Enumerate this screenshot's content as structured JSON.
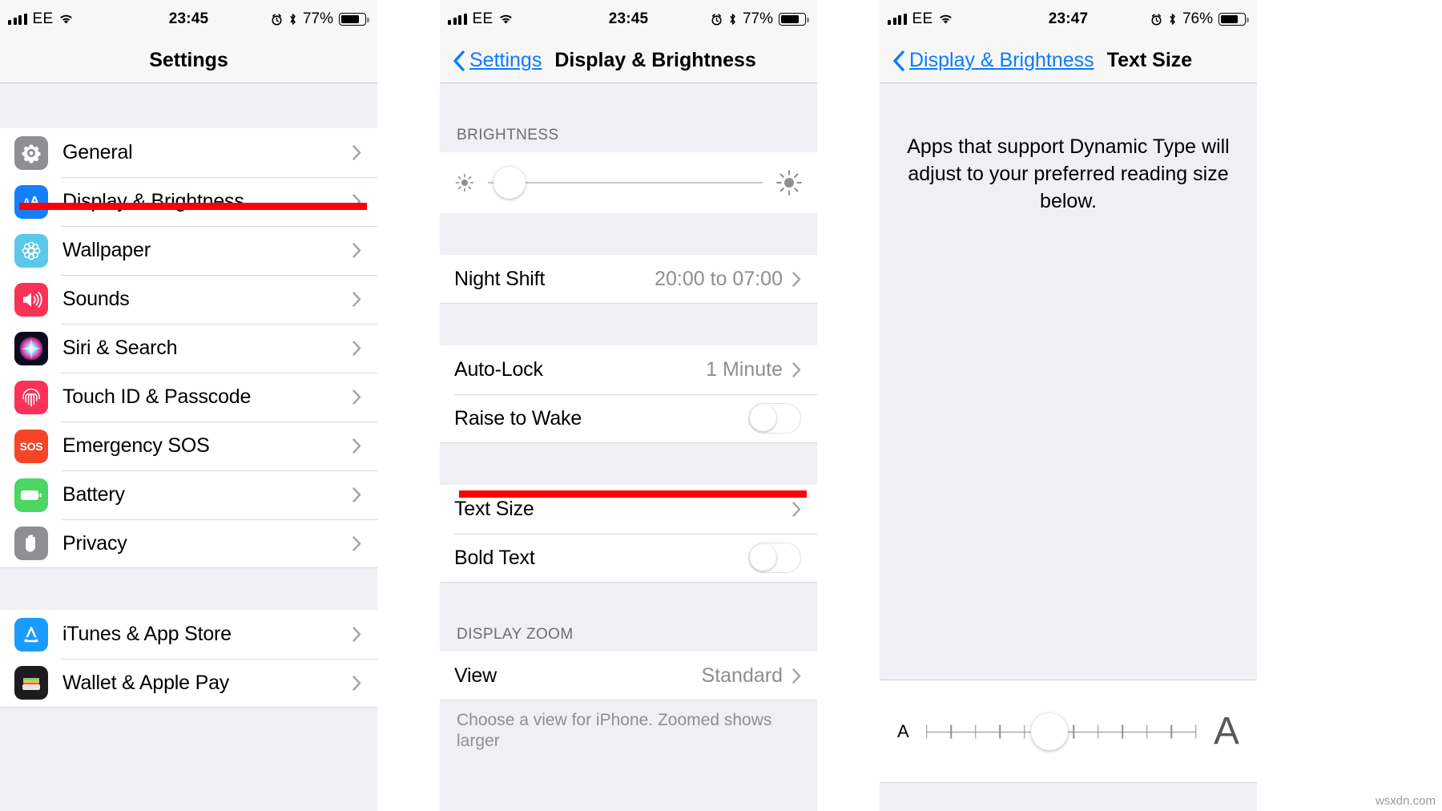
{
  "watermark": "wsxdn.com",
  "colors": {
    "accent": "#0a7cff",
    "highlight": "#fb0007",
    "section_bg": "#efeff4",
    "value_gray": "#8e8e93"
  },
  "panel1": {
    "status": {
      "carrier": "EE",
      "time": "23:45",
      "battery": "77%",
      "icons": [
        "signal-bars-icon",
        "wifi-icon",
        "alarm-icon",
        "bluetooth-icon",
        "battery-icon"
      ]
    },
    "nav": {
      "title": "Settings"
    },
    "items": [
      {
        "label": "General",
        "icon": "gear-icon"
      },
      {
        "label": "Display & Brightness",
        "icon": "text-size-aa-icon",
        "highlighted": true
      },
      {
        "label": "Wallpaper",
        "icon": "flower-icon"
      },
      {
        "label": "Sounds",
        "icon": "speaker-icon"
      },
      {
        "label": "Siri & Search",
        "icon": "siri-orb-icon"
      },
      {
        "label": "Touch ID & Passcode",
        "icon": "fingerprint-icon"
      },
      {
        "label": "Emergency SOS",
        "icon": "sos-icon"
      },
      {
        "label": "Battery",
        "icon": "battery-icon"
      },
      {
        "label": "Privacy",
        "icon": "hand-icon"
      }
    ],
    "items2": [
      {
        "label": "iTunes & App Store",
        "icon": "app-store-icon"
      },
      {
        "label": "Wallet & Apple Pay",
        "icon": "wallet-icon"
      }
    ]
  },
  "panel2": {
    "status": {
      "carrier": "EE",
      "time": "23:45",
      "battery": "77%"
    },
    "nav": {
      "back_label": "Settings",
      "title": "Display & Brightness"
    },
    "brightness": {
      "header": "BRIGHTNESS",
      "value_percent": 8,
      "icon_low": "sun-small-icon",
      "icon_high": "sun-large-icon"
    },
    "rows": [
      {
        "label": "Night Shift",
        "value": "20:00 to 07:00",
        "type": "disclosure"
      },
      {
        "label": "Auto-Lock",
        "value": "1 Minute",
        "type": "disclosure"
      },
      {
        "label": "Raise to Wake",
        "value": "off",
        "type": "toggle"
      },
      {
        "label": "Text Size",
        "value": "",
        "type": "disclosure",
        "highlighted": true
      },
      {
        "label": "Bold Text",
        "value": "off",
        "type": "toggle"
      }
    ],
    "zoom_section": {
      "header": "DISPLAY ZOOM",
      "row_label": "View",
      "row_value": "Standard",
      "footnote": "Choose a view for iPhone. Zoomed shows larger"
    }
  },
  "panel3": {
    "status": {
      "carrier": "EE",
      "time": "23:47",
      "battery": "76%"
    },
    "nav": {
      "back_label": "Display & Brightness",
      "title": "Text Size"
    },
    "description": "Apps that support Dynamic Type will adjust to your preferred reading size below.",
    "slider": {
      "left_label": "A",
      "right_label": "A",
      "ticks": 12,
      "value_index": 5
    }
  }
}
